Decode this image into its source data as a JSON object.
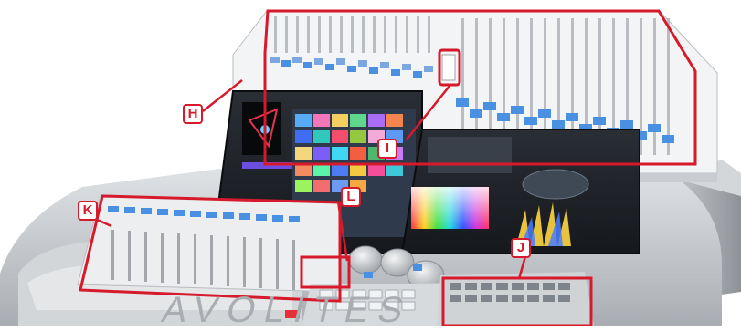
{
  "brand": {
    "name": "AVOLITES"
  },
  "callouts": {
    "h": "H",
    "i": "I",
    "j": "J",
    "k": "K",
    "l": "L"
  },
  "colors": {
    "highlight": "#d6192b",
    "fader_cap": "#4a90e2",
    "body": "#c9ccd0",
    "panel": "#e8eaec",
    "screen": "#1c1f24"
  },
  "icons": [
    "fader-icon",
    "jog-wheel-icon",
    "color-picker-icon"
  ]
}
